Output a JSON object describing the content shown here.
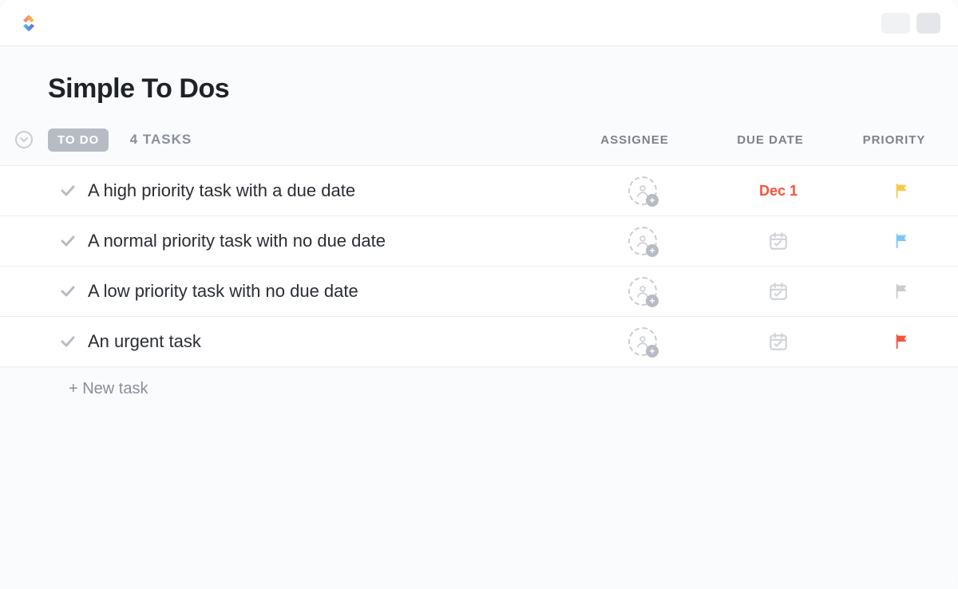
{
  "list": {
    "title": "Simple To Dos",
    "status_label": "TO DO",
    "task_count_label": "4 TASKS",
    "new_task_label": "+ New task"
  },
  "columns": {
    "assignee": "ASSIGNEE",
    "due_date": "DUE DATE",
    "priority": "PRIORITY"
  },
  "tasks": [
    {
      "title": "A high priority task with a due date",
      "due": "Dec 1",
      "due_style": "red",
      "priority": "high",
      "priority_color": "#f7c948"
    },
    {
      "title": "A normal priority task with no due date",
      "due": "",
      "due_style": "",
      "priority": "normal",
      "priority_color": "#7bc6f5"
    },
    {
      "title": "A low priority task with no due date",
      "due": "",
      "due_style": "",
      "priority": "low",
      "priority_color": "#c9ccd1"
    },
    {
      "title": "An urgent task",
      "due": "",
      "due_style": "",
      "priority": "urgent",
      "priority_color": "#f5533d"
    }
  ]
}
